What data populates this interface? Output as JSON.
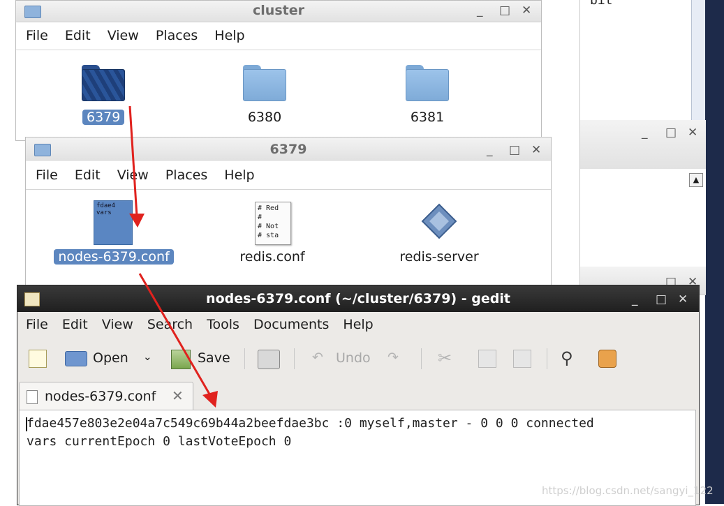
{
  "cluster_window": {
    "title": "cluster",
    "menu": [
      "File",
      "Edit",
      "View",
      "Places",
      "Help"
    ],
    "folders": [
      {
        "name": "6379",
        "selected": true
      },
      {
        "name": "6380",
        "selected": false
      },
      {
        "name": "6381",
        "selected": false
      }
    ],
    "controls": {
      "minimize": "_",
      "maximize": "□",
      "close": "✕"
    }
  },
  "folder_window": {
    "title": "6379",
    "menu": [
      "File",
      "Edit",
      "View",
      "Places",
      "Help"
    ],
    "files": [
      {
        "name": "nodes-6379.conf",
        "preview": "fdae4\nvars",
        "selected": true
      },
      {
        "name": "redis.conf",
        "preview": "# Red\n#\n# Not\n# sta",
        "selected": false
      },
      {
        "name": "redis-server",
        "selected": false
      }
    ]
  },
  "background": {
    "editor_text": "bit"
  },
  "gedit": {
    "title": "nodes-6379.conf (~/cluster/6379) - gedit",
    "menu": [
      "File",
      "Edit",
      "View",
      "Search",
      "Tools",
      "Documents",
      "Help"
    ],
    "toolbar": {
      "open": "Open",
      "save": "Save",
      "undo": "Undo"
    },
    "tab_label": "nodes-6379.conf",
    "content_lines": [
      "fdae457e803e2e04a7c549c69b44a2beefdae3bc :0 myself,master - 0 0 0 connected",
      "vars currentEpoch 0 lastVoteEpoch 0"
    ]
  },
  "watermark": "https://blog.csdn.net/sangyi_122",
  "colors": {
    "arrow": "#e0221e",
    "selection": "#5c86bf",
    "gedit_titlebar": "#2a2a2a"
  }
}
